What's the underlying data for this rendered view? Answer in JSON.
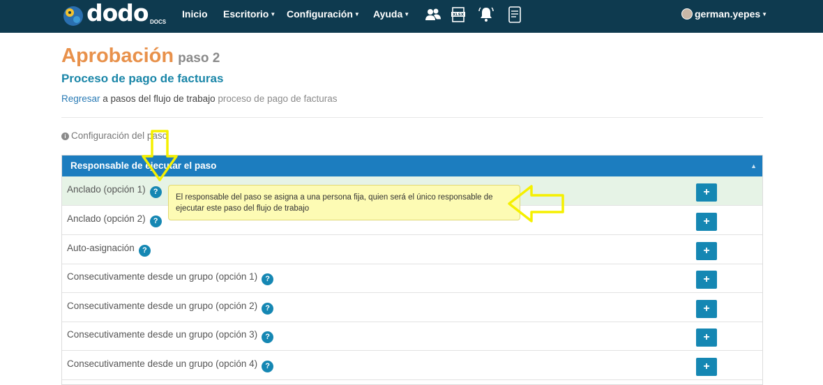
{
  "navbar": {
    "logo_text": "dodo",
    "logo_sub": "DOCS",
    "items": [
      {
        "label": "Inicio"
      },
      {
        "label": "Escritorio"
      },
      {
        "label": "Configuración"
      },
      {
        "label": "Ayuda"
      }
    ],
    "icons": [
      "users-icon",
      "xlsx-icon",
      "bell-icon",
      "document-icon"
    ],
    "user": "german.yepes"
  },
  "page": {
    "title": "Aprobación",
    "step": "paso 2",
    "process_title": "Proceso de pago de facturas",
    "breadcrumb": {
      "link": "Regresar",
      "middle": " a pasos del flujo de trabajo ",
      "muted": "proceso de pago de facturas"
    },
    "config_label": "Configuración del paso"
  },
  "panel": {
    "header": "Responsable de ejecutar el paso",
    "rows": [
      {
        "label": "Anclado (opción 1)"
      },
      {
        "label": "Anclado (opción 2)"
      },
      {
        "label": "Auto-asignación"
      },
      {
        "label": "Consecutivamente desde un grupo (opción 1)"
      },
      {
        "label": "Consecutivamente desde un grupo (opción 2)"
      },
      {
        "label": "Consecutivamente desde un grupo (opción 3)"
      },
      {
        "label": "Consecutivamente desde un grupo (opción 4)"
      }
    ],
    "add_symbol": "+",
    "help_symbol": "?"
  },
  "tooltip": {
    "text": "El responsable del paso se asigna a una persona fija, quien será el único responsable de ejecutar este paso del flujo de trabajo"
  },
  "colors": {
    "navbar": "#0e3a4f",
    "title": "#e8914b",
    "accent": "#1587b3",
    "header": "#1c7dbf",
    "annotation": "#f5f000"
  }
}
